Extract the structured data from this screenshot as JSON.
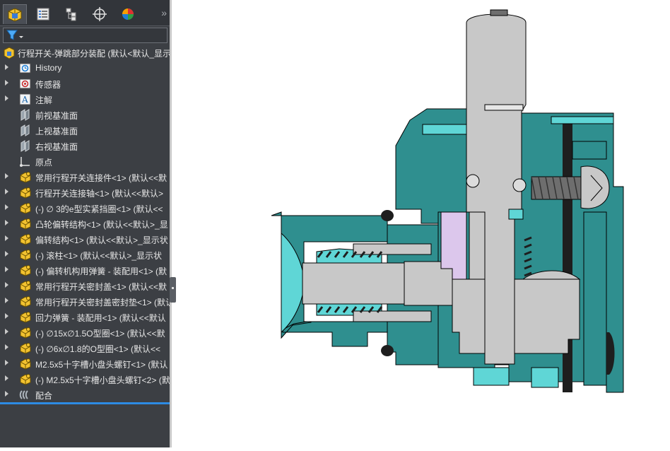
{
  "tabs": [
    {
      "name": "featuremanager-tab",
      "icon": "assembly-cube-icon"
    },
    {
      "name": "propertymanager-tab",
      "icon": "property-list-icon"
    },
    {
      "name": "configurationmanager-tab",
      "icon": "configuration-tree-icon"
    },
    {
      "name": "dimxpert-tab",
      "icon": "crosshair-icon"
    },
    {
      "name": "display-manager-tab",
      "icon": "color-ball-icon"
    }
  ],
  "more_glyph": "»",
  "filter": {
    "icon": "funnel-icon"
  },
  "root": {
    "label": "行程开关-弹跳部分装配  (默认<默认_显示"
  },
  "tree": [
    {
      "label": "History",
      "icon": "history-icon"
    },
    {
      "label": "传感器",
      "icon": "sensor-icon"
    },
    {
      "label": "注解",
      "icon": "annotation-icon"
    },
    {
      "label": "前视基准面",
      "icon": "plane-icon"
    },
    {
      "label": "上视基准面",
      "icon": "plane-icon"
    },
    {
      "label": "右视基准面",
      "icon": "plane-icon"
    },
    {
      "label": "原点",
      "icon": "origin-icon"
    },
    {
      "label": "常用行程开关连接件<1> (默认<<默",
      "icon": "part-icon"
    },
    {
      "label": "行程开关连接轴<1> (默认<<默认>",
      "icon": "part-icon"
    },
    {
      "label": "(-) ∅ 3的e型实紧挡圈<1> (默认<<",
      "icon": "part-icon"
    },
    {
      "label": "凸轮偏转结构<1> (默认<<默认>_显",
      "icon": "part-icon"
    },
    {
      "label": "偏转结构<1> (默认<<默认>_显示状",
      "icon": "part-icon"
    },
    {
      "label": "(-) 滚柱<1> (默认<<默认>_显示状",
      "icon": "part-icon"
    },
    {
      "label": "(-) 偏转机构用弹簧 - 装配用<1> (默",
      "icon": "part-icon"
    },
    {
      "label": "常用行程开关密封盖<1> (默认<<默",
      "icon": "part-icon"
    },
    {
      "label": "常用行程开关密封盖密封垫<1> (默认",
      "icon": "part-icon"
    },
    {
      "label": "回力弹簧 - 装配用<1> (默认<<默认",
      "icon": "part-icon"
    },
    {
      "label": "(-) ∅15x∅1.5O型圈<1> (默认<<默",
      "icon": "part-icon"
    },
    {
      "label": "(-) ∅6x∅1.8的O型圈<1> (默认<<",
      "icon": "part-icon"
    },
    {
      "label": "M2.5x5十字槽小盘头螺钉<1> (默认",
      "icon": "part-icon"
    },
    {
      "label": "(-) M2.5x5十字槽小盘头螺钉<2> (默",
      "icon": "part-icon"
    },
    {
      "label": "配合",
      "icon": "mates-icon"
    }
  ],
  "colors": {
    "panel_bg": "#3c3f44",
    "accent": "#2d8be3",
    "housing": "#2f8f8f",
    "housing_cut": "#5fd6d6",
    "steel": "#c8c8c8",
    "steel_dark": "#6e6e6e",
    "rubber": "#1e1e1e"
  }
}
